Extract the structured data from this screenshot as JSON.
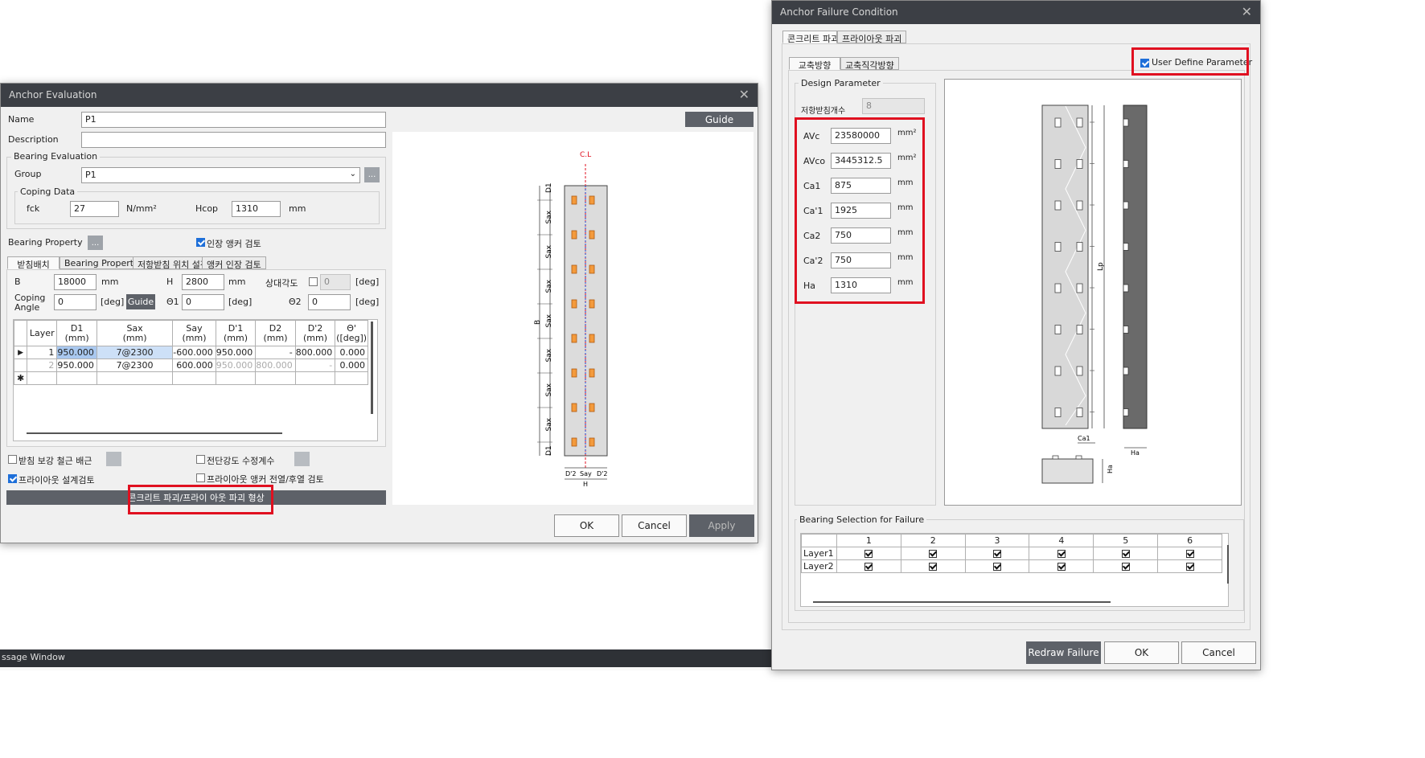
{
  "anchor_eval": {
    "title": "Anchor Evaluation",
    "close": "✕",
    "name_label": "Name",
    "name_value": "P1",
    "desc_label": "Description",
    "desc_value": "",
    "guide_btn": "Guide",
    "bearing_eval_label": "Bearing Evaluation",
    "group_label": "Group",
    "group_value": "P1",
    "group_more": "...",
    "coping_label": "Coping Data",
    "fck_label": "fck",
    "fck_value": "27",
    "fck_unit": "N/mm²",
    "hcop_label": "Hcop",
    "hcop_value": "1310",
    "hcop_unit": "mm",
    "bearing_prop_label": "Bearing Property",
    "bearing_prop_more": "...",
    "tension_check_label": "인장 앵커 검토",
    "tabs": [
      "받침배치",
      "Bearing Property",
      "저항받침 위치 설정",
      "앵커 인장 검토"
    ],
    "b_label": "B",
    "b_value": "18000",
    "b_unit": "mm",
    "h_label": "H",
    "h_value": "2800",
    "h_unit": "mm",
    "rel_angle_label": "상대각도",
    "rel_angle_value": "0",
    "rel_angle_unit": "[deg]",
    "coping_angle_label1": "Coping",
    "coping_angle_label2": "Angle",
    "coping_angle_value": "0",
    "coping_angle_unit": "[deg]",
    "guide_small": "Guide",
    "t1_label": "Θ1",
    "t1_value": "0",
    "t1_unit": "[deg]",
    "t2_label": "Θ2",
    "t2_value": "0",
    "t2_unit": "[deg]",
    "table": {
      "headers": [
        "Layer",
        "D1\n(mm)",
        "Sax\n(mm)",
        "Say\n(mm)",
        "D'1\n(mm)",
        "D2\n(mm)",
        "D'2\n(mm)",
        "Θ'\n([deg])"
      ],
      "rows": [
        [
          "1",
          "950.000",
          "7@2300",
          "-600.000",
          "950.000",
          "-",
          "800.000",
          "0.000"
        ],
        [
          "2",
          "950.000",
          "7@2300",
          "600.000",
          "950.000",
          "800.000",
          "-",
          "0.000"
        ]
      ]
    },
    "rebar_label": "받침 보강 철근 배근",
    "shear_label": "전단강도 수정계수",
    "pryout_label": "프라이아웃 설계검토",
    "pryout_anchor_label": "프라이아웃 앵커 전열/후열 검토",
    "failure_shape_btn": "콘크리트 파괴/프라이 아웃 파괴 형상",
    "ok": "OK",
    "cancel": "Cancel",
    "apply": "Apply",
    "drawing": {
      "cl": "C.L",
      "b": "B",
      "h": "H",
      "d1": "D1",
      "sax": "Sax",
      "d2": "D'2",
      "say": "Say"
    }
  },
  "anchor_failure": {
    "title": "Anchor Failure Condition",
    "close": "✕",
    "tabs": [
      "콘크리트 파괴",
      "프라이아웃 파괴"
    ],
    "subtabs": [
      "교축방향",
      "교축직각방향"
    ],
    "user_define": "User Define Parameter",
    "design_param_label": "Design Parameter",
    "count_label": "저항받침개수",
    "count_value": "8",
    "params": [
      {
        "label": "AVc",
        "value": "23580000",
        "unit": "mm²"
      },
      {
        "label": "AVco",
        "value": "3445312.5",
        "unit": "mm²"
      },
      {
        "label": "Ca1",
        "value": "875",
        "unit": "mm"
      },
      {
        "label": "Ca'1",
        "value": "1925",
        "unit": "mm"
      },
      {
        "label": "Ca2",
        "value": "750",
        "unit": "mm"
      },
      {
        "label": "Ca'2",
        "value": "750",
        "unit": "mm"
      },
      {
        "label": "Ha",
        "value": "1310",
        "unit": "mm"
      }
    ],
    "drawing": {
      "lp": "Lp",
      "ca1": "Ca1",
      "ha": "Ha",
      "ha2": "Ha"
    },
    "bearing_sel_label": "Bearing Selection for Failure",
    "cols": [
      "1",
      "2",
      "3",
      "4",
      "5",
      "6"
    ],
    "rows": [
      "Layer1",
      "Layer2"
    ],
    "redraw": "Redraw Failure",
    "ok": "OK",
    "cancel": "Cancel"
  },
  "message_window": "ssage Window"
}
